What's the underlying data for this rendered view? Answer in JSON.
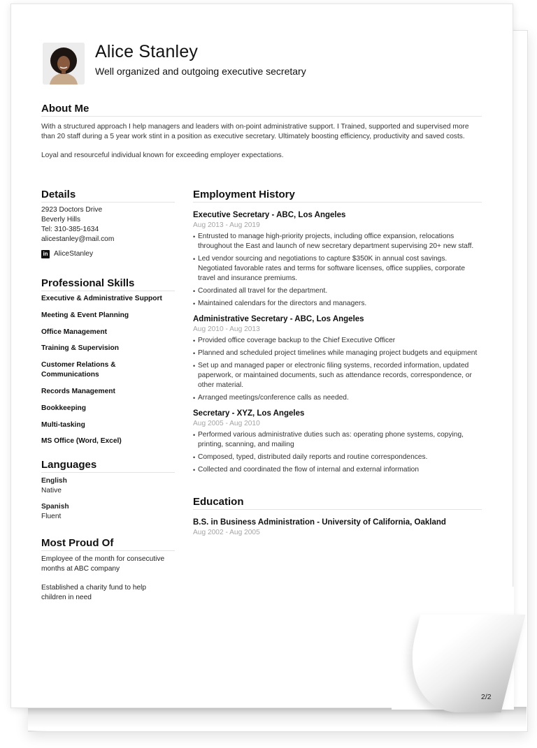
{
  "document": {
    "page_number": "2/2"
  },
  "header": {
    "name": "Alice Stanley",
    "subtitle": "Well organized and outgoing executive secretary",
    "photo_alt": "profile-photo"
  },
  "about": {
    "heading": "About Me",
    "paragraphs": [
      "With a structured approach I help managers and leaders with on-point administrative support. I Trained, supported and supervised more than 20 staff during a 5 year work stint in a position as executive secretary. Ultimately boosting efficiency, productivity and saved costs.",
      "Loyal and resourceful individual known for exceeding employer expectations."
    ]
  },
  "details": {
    "heading": "Details",
    "address_line1": "2923 Doctors Drive",
    "address_line2": "Beverly Hills",
    "phone": "Tel: 310-385-1634",
    "email": "alicestanley@mail.com",
    "linkedin_icon": "in",
    "linkedin": "AliceStanley"
  },
  "skills": {
    "heading": "Professional Skills",
    "items": [
      "Executive & Administrative Support",
      "Meeting & Event Planning",
      "Office Management",
      "Training & Supervision",
      "Customer Relations & Communications",
      "Records Management",
      "Bookkeeping",
      "Multi-tasking",
      "MS Office (Word, Excel)"
    ]
  },
  "languages": {
    "heading": "Languages",
    "items": [
      {
        "name": "English",
        "level": "Native"
      },
      {
        "name": "Spanish",
        "level": "Fluent"
      }
    ]
  },
  "proud": {
    "heading": "Most Proud Of",
    "items": [
      "Employee of the month for consecutive months at ABC company",
      "Established a charity fund to help children in need"
    ]
  },
  "employment": {
    "heading": "Employment History",
    "jobs": [
      {
        "title": "Executive Secretary - ABC, Los Angeles",
        "dates": "Aug 2013 - Aug 2019",
        "bullets": [
          "Entrusted to manage high-priority projects, including office expansion, relocations throughout the East and launch of new secretary department supervising 20+ new staff.",
          "Led vendor sourcing and negotiations to capture $350K in annual cost savings. Negotiated favorable rates and terms for software licenses, office supplies, corporate travel and insurance premiums.",
          "Coordinated all travel for the department.",
          "Maintained calendars for the directors and managers."
        ]
      },
      {
        "title": "Administrative Secretary - ABC, Los Angeles",
        "dates": "Aug 2010 - Aug 2013",
        "bullets": [
          "Provided office coverage backup to the Chief Executive Officer",
          "Planned and scheduled project timelines while managing project budgets and equipment",
          "Set up and managed paper or electronic filing systems, recorded information, updated paperwork, or maintained documents, such as attendance records, correspondence, or other material.",
          "Arranged meetings/conference calls as needed."
        ]
      },
      {
        "title": "Secretary - XYZ, Los Angeles",
        "dates": "Aug 2005 - Aug 2010",
        "bullets": [
          "Performed various administrative duties such as: operating phone systems, copying, printing, scanning, and mailing",
          "Composed, typed, distributed daily reports and routine correspondences.",
          "Collected and coordinated the flow of internal and external information"
        ]
      }
    ]
  },
  "education": {
    "heading": "Education",
    "items": [
      {
        "title": "B.S. in Business Administration - University of California, Oakland",
        "dates": "Aug 2002 - Aug 2005"
      }
    ]
  }
}
